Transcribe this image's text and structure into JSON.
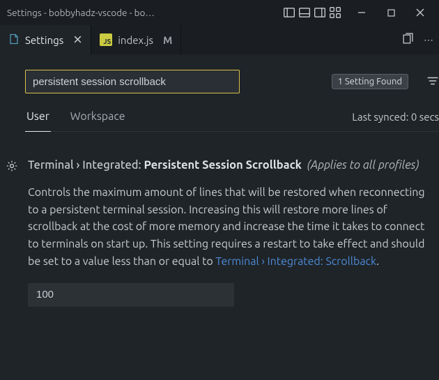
{
  "titlebar": {
    "title": "Settings - bobbyhadz-vscode - bo…"
  },
  "tabs": {
    "settings": {
      "label": "Settings"
    },
    "indexjs": {
      "label": "index.js",
      "dirty": "M"
    }
  },
  "search": {
    "value": "persistent session scrollback",
    "found_badge": "1 Setting Found"
  },
  "scopes": {
    "user": "User",
    "workspace": "Workspace",
    "sync": "Last synced: 0 secs"
  },
  "setting": {
    "breadcrumb": "Terminal › Integrated: ",
    "name": "Persistent Session Scrollback",
    "scope_hint": "(Applies to all profiles)",
    "description_pre": "Controls the maximum amount of lines that will be restored when reconnecting to a persistent terminal session. Increasing this will restore more lines of scrollback at the cost of more memory and increase the time it takes to connect to terminals on start up. This setting requires a restart to take effect and should be set to a value less than or equal to ",
    "description_link": "Terminal › Integrated: Scrollback",
    "description_post": ".",
    "value": "100"
  }
}
